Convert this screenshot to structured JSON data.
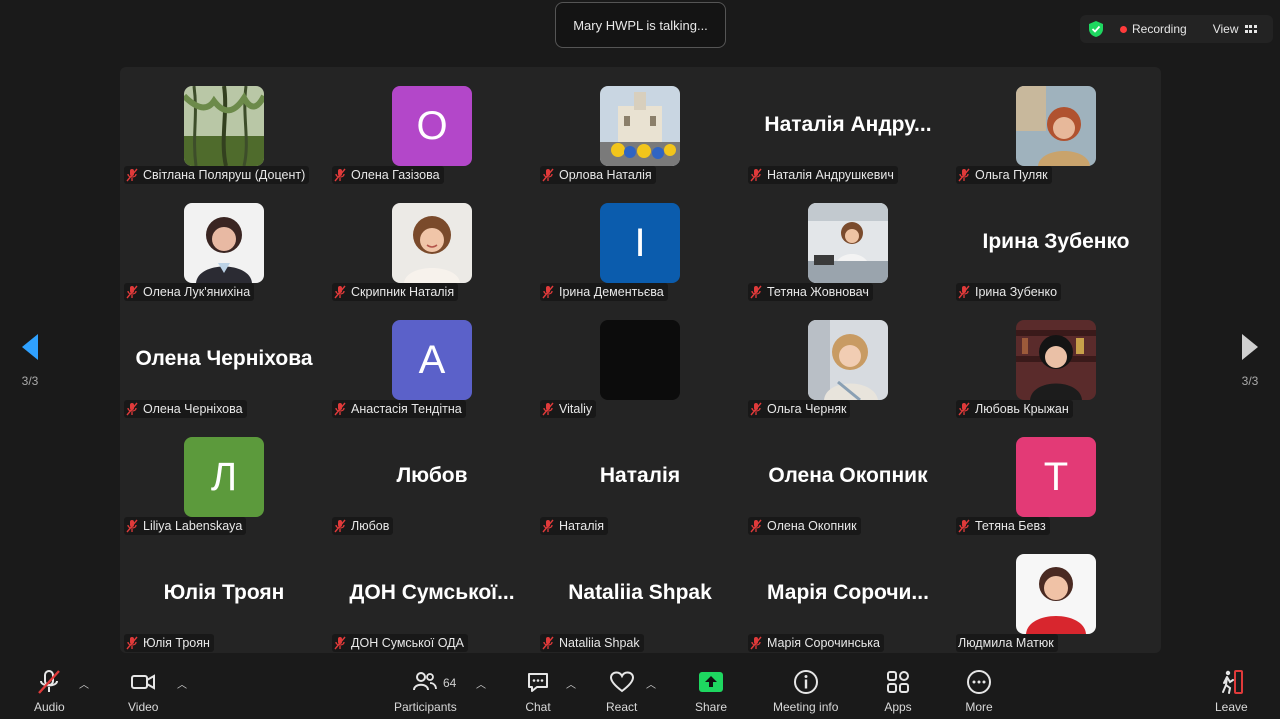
{
  "talking_indicator": "Mary HWPL is talking...",
  "top_right": {
    "recording_label": "Recording",
    "view_label": "View"
  },
  "pager": {
    "page_left": "3/3",
    "page_right": "3/3"
  },
  "colors": {
    "accent_blue": "#2fa1ff",
    "share_green": "#1ed760",
    "mute_red": "#e03a3a"
  },
  "participants": [
    {
      "name": "Світлана Поляруш (Доцент)",
      "avatar": "photo",
      "photo": "willow-trees"
    },
    {
      "name": "Олена Газізова",
      "avatar": "letter",
      "letter": "О",
      "color": "#b347c9"
    },
    {
      "name": "Орлова Наталія",
      "avatar": "photo",
      "photo": "church-flowers"
    },
    {
      "name": "Наталія Андрушкевич",
      "avatar": "text",
      "display": "Наталія  Андру..."
    },
    {
      "name": "Ольга Пуляк",
      "avatar": "photo",
      "photo": "woman-red-hair"
    },
    {
      "name": "Олена Лук'янихіна",
      "avatar": "photo",
      "photo": "woman-dark-hair"
    },
    {
      "name": "Скрипник Наталія",
      "avatar": "photo",
      "photo": "woman-smiling"
    },
    {
      "name": "Ірина Дементьєва",
      "avatar": "letter",
      "letter": "І",
      "color": "#0b5cad"
    },
    {
      "name": "Тетяна Жовновач",
      "avatar": "photo",
      "photo": "woman-at-desk"
    },
    {
      "name": "Ірина Зубенко",
      "avatar": "text",
      "display": "Ірина Зубенко"
    },
    {
      "name": "Олена Черніхова",
      "avatar": "text",
      "display": "Олена Черніхова"
    },
    {
      "name": "Анастасія Тендітна",
      "avatar": "letter",
      "letter": "А",
      "color": "#5b61c9"
    },
    {
      "name": "Vitaliy",
      "avatar": "blank"
    },
    {
      "name": "Ольга Черняк",
      "avatar": "photo",
      "photo": "woman-blonde"
    },
    {
      "name": "Любовь Крыжан",
      "avatar": "photo",
      "photo": "woman-bookshelf"
    },
    {
      "name": "Liliya Labenskaya",
      "avatar": "letter",
      "letter": "Л",
      "color": "#5c9a3c"
    },
    {
      "name": "Любов",
      "avatar": "text",
      "display": "Любов"
    },
    {
      "name": "Наталія",
      "avatar": "text",
      "display": "Наталія"
    },
    {
      "name": "Олена Окопник",
      "avatar": "text",
      "display": "Олена Окопник"
    },
    {
      "name": "Тетяна Бевз",
      "avatar": "letter",
      "letter": "Т",
      "color": "#e33a76"
    },
    {
      "name": "Юлія Троян",
      "avatar": "text",
      "display": "Юлія Троян"
    },
    {
      "name": "ДОН Сумської ОДА",
      "avatar": "text",
      "display": "ДОН  Сумської..."
    },
    {
      "name": "Nataliia Shpak",
      "avatar": "text",
      "display": "Nataliia Shpak"
    },
    {
      "name": "Марія Сорочинська",
      "avatar": "text",
      "display": "Марія  Сорочи..."
    },
    {
      "name": "Людмила Матюк",
      "avatar": "photo",
      "photo": "woman-red-top",
      "unmuted": true
    }
  ],
  "toolbar": {
    "audio": "Audio",
    "video": "Video",
    "participants": "Participants",
    "participants_count": "64",
    "chat": "Chat",
    "react": "React",
    "share": "Share",
    "meeting_info": "Meeting info",
    "apps": "Apps",
    "more": "More",
    "leave": "Leave"
  }
}
